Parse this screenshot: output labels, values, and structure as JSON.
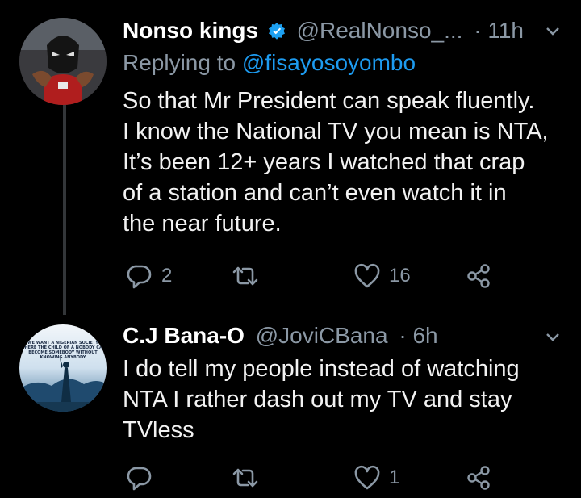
{
  "tweets": [
    {
      "name": "Nonso kings",
      "verified": true,
      "handle": "@RealNonso_...",
      "time": "· 11h",
      "replying_prefix": "Replying to",
      "replying_to": "@fisayosoyombo",
      "lines": [
        "So that Mr President can speak fluently.",
        "I know the National TV you mean is NTA,",
        "It’s been 12+ years I watched that crap",
        "of a station and can’t even watch it in",
        "the near future."
      ],
      "reply_count": "2",
      "retweet_count": "",
      "like_count": "16"
    },
    {
      "name": "C.J Bana-O",
      "handle": "@JoviCBana",
      "time": "· 6h",
      "avatar_text": [
        "WE WANT A NIGERIAN SOCIETY",
        "WHERE THE CHILD OF A NOBODY CAN",
        "BECOME SOMEBODY WITHOUT",
        "KNOWING ANYBODY"
      ],
      "lines": [
        "I do tell my people instead of watching",
        "NTA I rather dash out my TV and stay",
        "TVless"
      ],
      "reply_count": "",
      "retweet_count": "",
      "like_count": "1"
    }
  ],
  "colors": {
    "background": "#000000",
    "muted": "#8b98a5",
    "link": "#1d9bf0",
    "verified": "#1da1f2"
  },
  "icons": [
    "reply-icon",
    "retweet-icon",
    "like-icon",
    "share-icon",
    "chevron-down-icon",
    "verified-badge-icon"
  ]
}
